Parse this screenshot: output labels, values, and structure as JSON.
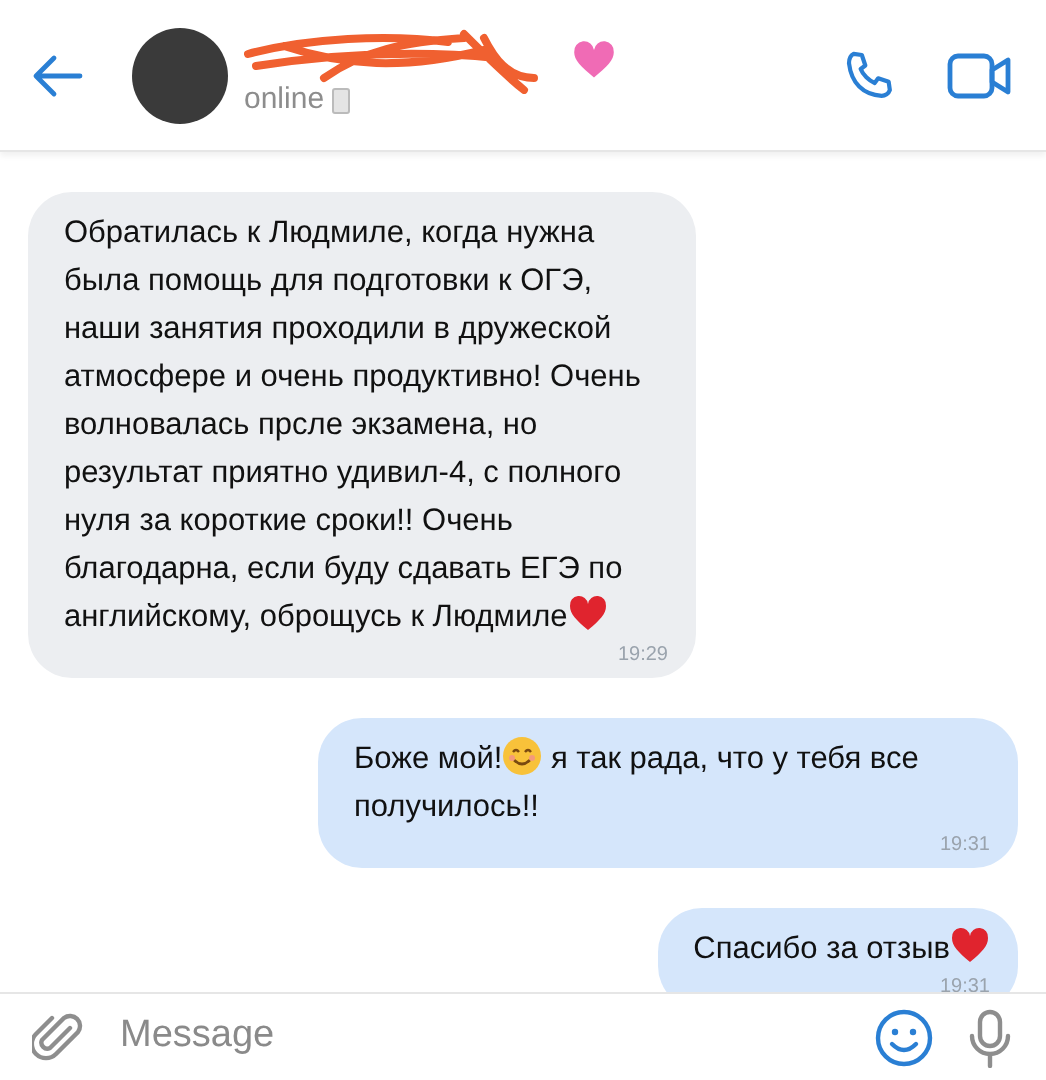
{
  "header": {
    "status": "online"
  },
  "messages": [
    {
      "kind": "incoming",
      "time": "19:29",
      "parts": [
        {
          "kind": "text",
          "text": "Обратилась к Людмиле, когда нужна была помощь для подготовки к ОГЭ, наши занятия проходили в дружеской атмосфере и очень продуктивно! Очень волновалась прсле экзамена, но результат приятно удивил-4, с полного нуля за короткие сроки!! Очень благодарна, если буду сдавать ЕГЭ по английскому, оброщусь к Людмиле"
        },
        {
          "kind": "heart"
        }
      ]
    },
    {
      "kind": "outgoing",
      "time": "19:31",
      "parts": [
        {
          "kind": "text",
          "text": "Боже мой!"
        },
        {
          "kind": "smile"
        },
        {
          "kind": "text",
          "text": " я так рада, что у тебя все получилось!!"
        }
      ]
    },
    {
      "kind": "outgoing",
      "time": "19:31",
      "parts": [
        {
          "kind": "text",
          "text": "Спасибо за отзыв"
        },
        {
          "kind": "heart"
        }
      ]
    }
  ],
  "composer": {
    "placeholder": "Message"
  }
}
